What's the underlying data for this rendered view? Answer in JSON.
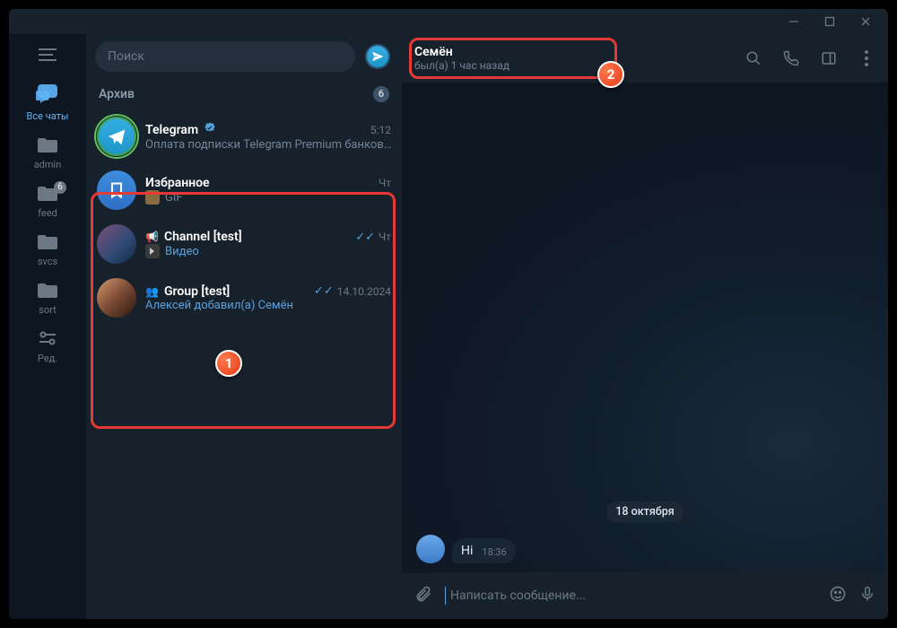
{
  "window_controls": {
    "min": "minimize",
    "max": "maximize",
    "close": "close"
  },
  "sidebar": {
    "menu": "menu",
    "folders": [
      {
        "id": "all",
        "label": "Все чаты",
        "active": true
      },
      {
        "id": "admin",
        "label": "admin"
      },
      {
        "id": "feed",
        "label": "feed",
        "badge": "6"
      },
      {
        "id": "svcs",
        "label": "svcs"
      },
      {
        "id": "sort",
        "label": "sort"
      },
      {
        "id": "edit",
        "label": "Ред."
      }
    ]
  },
  "search": {
    "placeholder": "Поиск"
  },
  "archive": {
    "label": "Архив",
    "count": "6"
  },
  "chats": [
    {
      "name": "Telegram",
      "verified": true,
      "time": "5:12",
      "preview": "Оплата подписки Telegram Premium банков…",
      "avatar": "telegram"
    },
    {
      "name": "Избранное",
      "time": "Чт",
      "preview": "GIF",
      "preview_kind": "gif",
      "avatar": "saved"
    },
    {
      "name": "Channel [test]",
      "prefix": "channel",
      "time": "Чт",
      "read": true,
      "preview": "Видео",
      "preview_kind": "video",
      "avatar": "img1"
    },
    {
      "name": "Group [test]",
      "prefix": "group",
      "time": "14.10.2024",
      "read": true,
      "preview": "Алексей добавил(а) Семён",
      "preview_kind": "action",
      "avatar": "img2"
    }
  ],
  "conv": {
    "name": "Семён",
    "status": "был(а) 1 час назад",
    "date": "18 октября",
    "messages": [
      {
        "text": "Hi",
        "time": "18:36"
      }
    ],
    "composer_placeholder": "Написать сообщение..."
  },
  "annotations": {
    "m1": "1",
    "m2": "2"
  }
}
